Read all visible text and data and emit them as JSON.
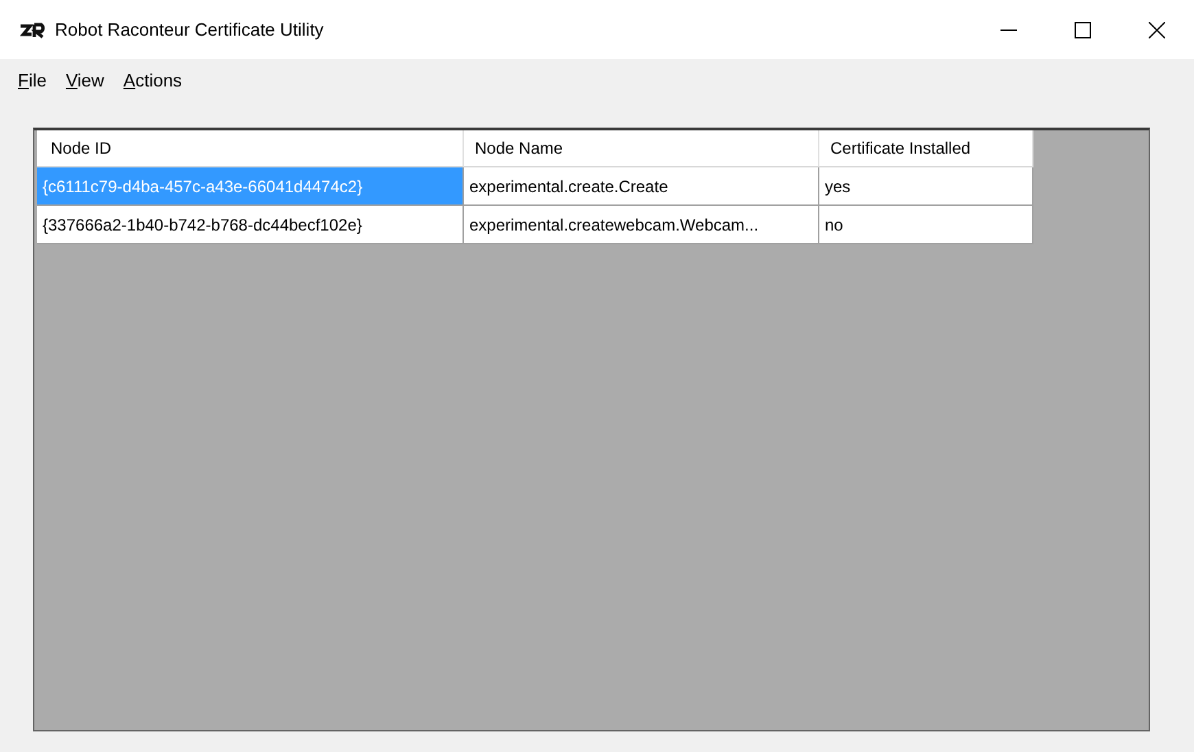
{
  "window": {
    "title": "Robot Raconteur Certificate Utility"
  },
  "menu": [
    {
      "label": "File"
    },
    {
      "label": "View"
    },
    {
      "label": "Actions"
    }
  ],
  "table": {
    "columns": [
      "Node ID",
      "Node Name",
      "Certificate Installed"
    ],
    "rows": [
      {
        "cells": [
          "{c6111c79-d4ba-457c-a43e-66041d4474c2}",
          "experimental.create.Create",
          "yes"
        ],
        "selected": true
      },
      {
        "cells": [
          "{337666a2-1b40-b742-b768-dc44becf102e}",
          "experimental.createwebcam.Webcam...",
          "no"
        ],
        "selected": false
      }
    ]
  }
}
